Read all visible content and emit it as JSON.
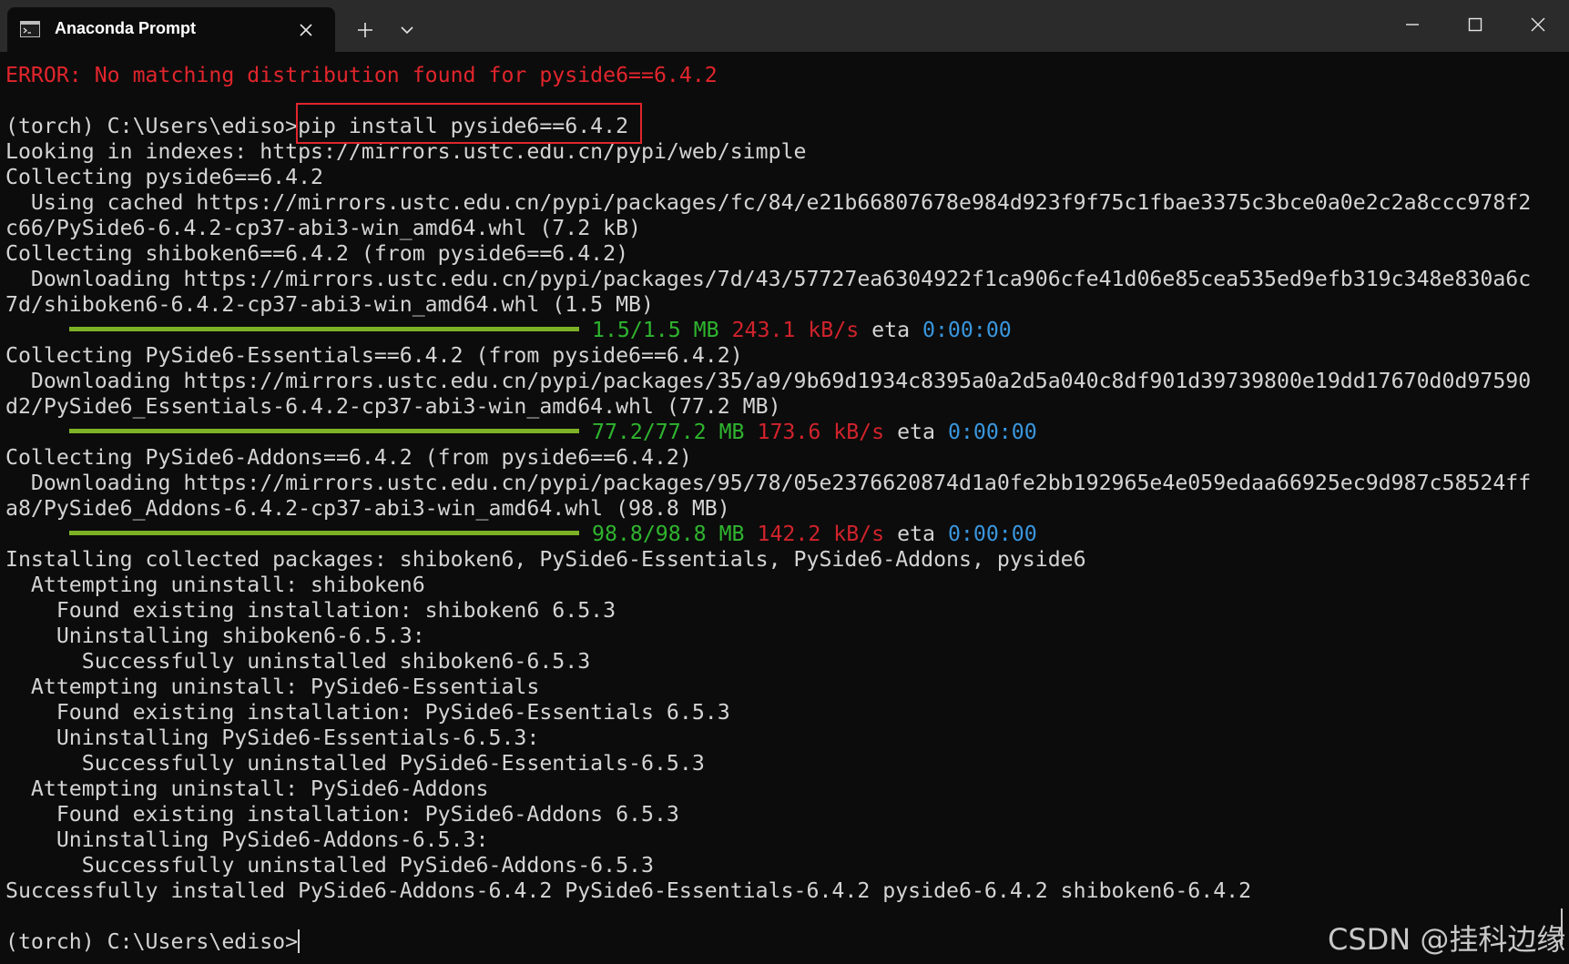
{
  "window": {
    "tab_title": "Anaconda Prompt",
    "tab_icon": "terminal-icon",
    "new_tab_icon": "plus-icon",
    "tab_menu_icon": "chevron-down-icon",
    "minimize_icon": "minimize-icon",
    "maximize_icon": "maximize-icon",
    "close_icon": "close-icon"
  },
  "colors": {
    "background": "#0c0c0c",
    "titlebar": "#2b2b2b",
    "text": "#d4d4d4",
    "error": "#e1252c",
    "progress_bar": "#7db226",
    "progress_text": "#2fb42f",
    "speed": "#d1232c",
    "eta": "#3a96dd",
    "highlight_box": "#e1252c"
  },
  "terminal": {
    "error_line": "ERROR: No matching distribution found for pyside6==6.4.2",
    "prompt": "(torch) C:\\Users\\ediso>",
    "command": "pip install pyside6==6.4.2",
    "lines_a": [
      "Looking in indexes: https://mirrors.ustc.edu.cn/pypi/web/simple",
      "Collecting pyside6==6.4.2",
      "  Using cached https://mirrors.ustc.edu.cn/pypi/packages/fc/84/e21b66807678e984d923f9f75c1fbae3375c3bce0a0e2c2a8ccc978f2",
      "c66/PySide6-6.4.2-cp37-abi3-win_amd64.whl (7.2 kB)",
      "Collecting shiboken6==6.4.2 (from pyside6==6.4.2)",
      "  Downloading https://mirrors.ustc.edu.cn/pypi/packages/7d/43/57727ea6304922f1ca906cfe41d06e85cea535ed9efb319c348e830a6c",
      "7d/shiboken6-6.4.2-cp37-abi3-win_amd64.whl (1.5 MB)"
    ],
    "progress_1": {
      "fraction": 1.0,
      "size": "1.5/1.5 MB",
      "speed": "243.1 kB/s",
      "eta_label": "eta",
      "eta": "0:00:00"
    },
    "lines_b": [
      "Collecting PySide6-Essentials==6.4.2 (from pyside6==6.4.2)",
      "  Downloading https://mirrors.ustc.edu.cn/pypi/packages/35/a9/9b69d1934c8395a0a2d5a040c8df901d39739800e19dd17670d0d97590",
      "d2/PySide6_Essentials-6.4.2-cp37-abi3-win_amd64.whl (77.2 MB)"
    ],
    "progress_2": {
      "fraction": 1.0,
      "size": "77.2/77.2 MB",
      "speed": "173.6 kB/s",
      "eta_label": "eta",
      "eta": "0:00:00"
    },
    "lines_c": [
      "Collecting PySide6-Addons==6.4.2 (from pyside6==6.4.2)",
      "  Downloading https://mirrors.ustc.edu.cn/pypi/packages/95/78/05e2376620874d1a0fe2bb192965e4e059edaa66925ec9d987c58524ff",
      "a8/PySide6_Addons-6.4.2-cp37-abi3-win_amd64.whl (98.8 MB)"
    ],
    "progress_3": {
      "fraction": 1.0,
      "size": "98.8/98.8 MB",
      "speed": "142.2 kB/s",
      "eta_label": "eta",
      "eta": "0:00:00"
    },
    "lines_d": [
      "Installing collected packages: shiboken6, PySide6-Essentials, PySide6-Addons, pyside6",
      "  Attempting uninstall: shiboken6",
      "    Found existing installation: shiboken6 6.5.3",
      "    Uninstalling shiboken6-6.5.3:",
      "      Successfully uninstalled shiboken6-6.5.3",
      "  Attempting uninstall: PySide6-Essentials",
      "    Found existing installation: PySide6-Essentials 6.5.3",
      "    Uninstalling PySide6-Essentials-6.5.3:",
      "      Successfully uninstalled PySide6-Essentials-6.5.3",
      "  Attempting uninstall: PySide6-Addons",
      "    Found existing installation: PySide6-Addons 6.5.3",
      "    Uninstalling PySide6-Addons-6.5.3:",
      "      Successfully uninstalled PySide6-Addons-6.5.3",
      "Successfully installed PySide6-Addons-6.4.2 PySide6-Essentials-6.4.2 pyside6-6.4.2 shiboken6-6.4.2"
    ],
    "final_prompt": "(torch) C:\\Users\\ediso>"
  },
  "watermark": "CSDN @挂科边缘"
}
